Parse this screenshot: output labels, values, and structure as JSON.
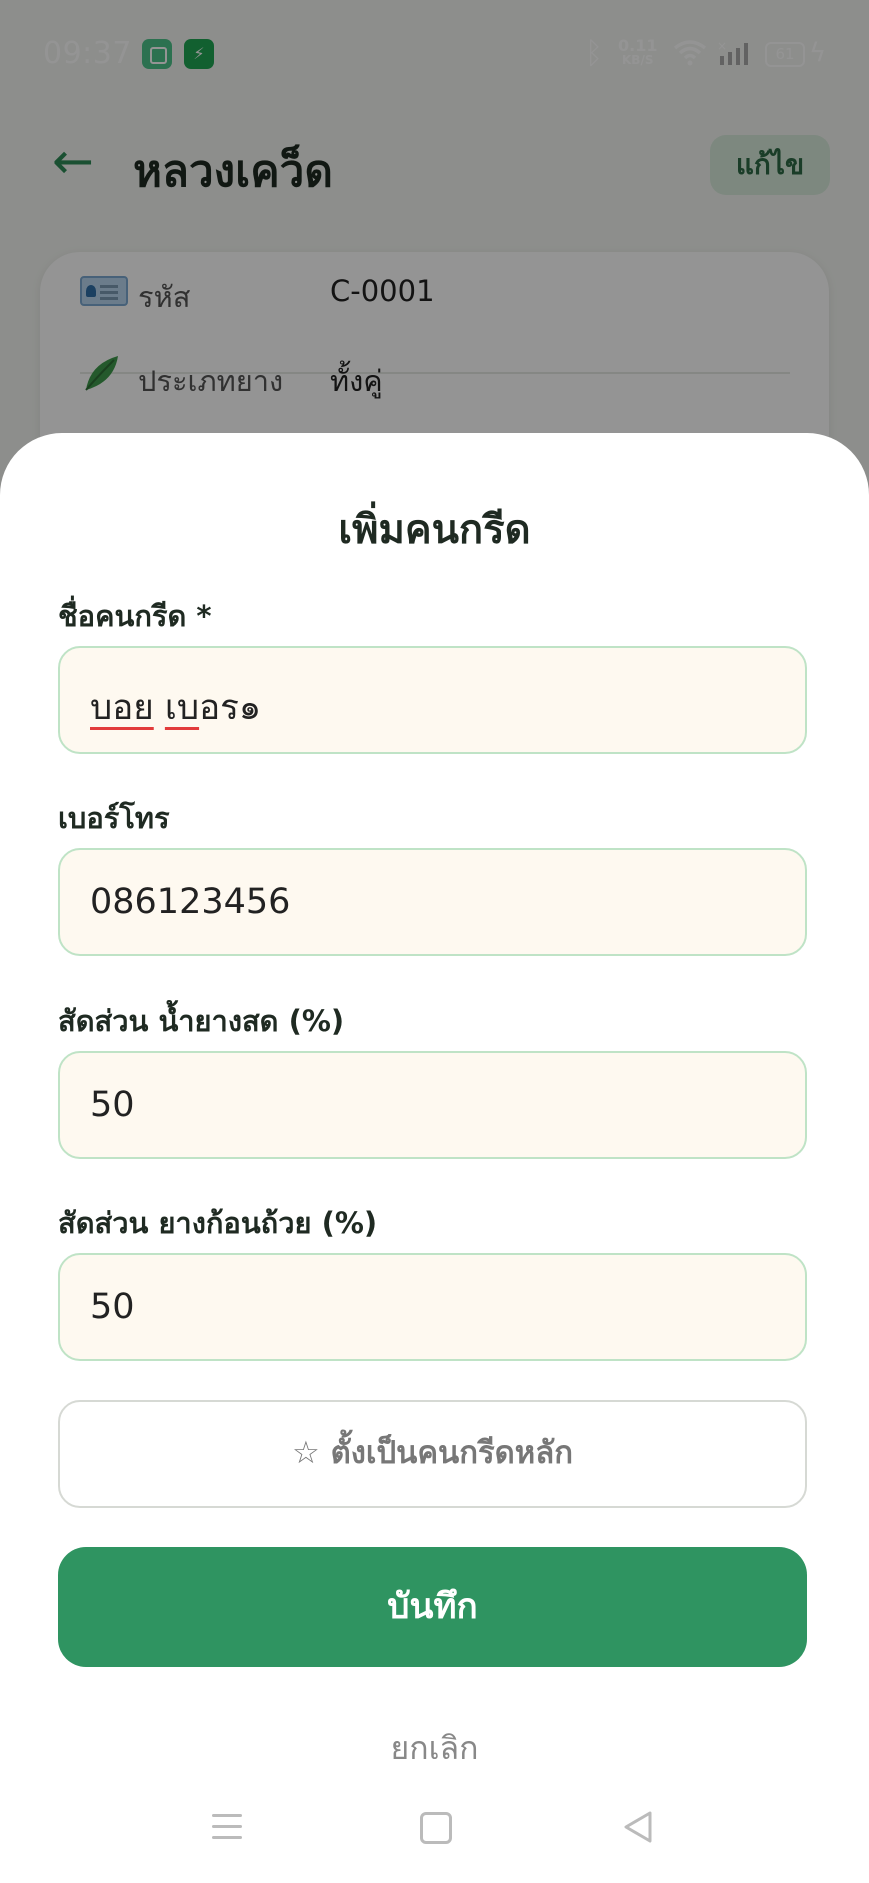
{
  "status_bar": {
    "time": "09:37",
    "net_speed_value": "0.11",
    "net_speed_unit": "KB/S",
    "battery": "61"
  },
  "header": {
    "back_icon": "←",
    "title": "หลวงเคว็ด",
    "edit_label": "แก้ไข"
  },
  "info": {
    "rows": [
      {
        "icon": "id-card-icon",
        "label": "รหัส",
        "value": "C-0001"
      },
      {
        "icon": "leaf-icon",
        "label": "ประเภทยาง",
        "value": "ทั้งคู่"
      }
    ]
  },
  "sheet": {
    "title": "เพิ่มคนกรีด",
    "fields": [
      {
        "label": "ชื่อคนกรีด *",
        "value_parts": [
          "บอย",
          " ",
          "เบ",
          "อร๑"
        ]
      },
      {
        "label": "เบอร์โทร",
        "value": "086123456"
      },
      {
        "label": "สัดส่วน น้ำยางสด (%)",
        "value": "50"
      },
      {
        "label": "สัดส่วน ยางก้อนถ้วย (%)",
        "value": "50"
      }
    ],
    "primary_toggle_label": "☆ ตั้งเป็นคนกรีดหลัก",
    "save_label": "บันทึก",
    "cancel_label": "ยกเลิก"
  },
  "colors": {
    "brand_green": "#2f9461",
    "field_border": "#bfe3c6",
    "field_bg": "#fef9f0"
  }
}
